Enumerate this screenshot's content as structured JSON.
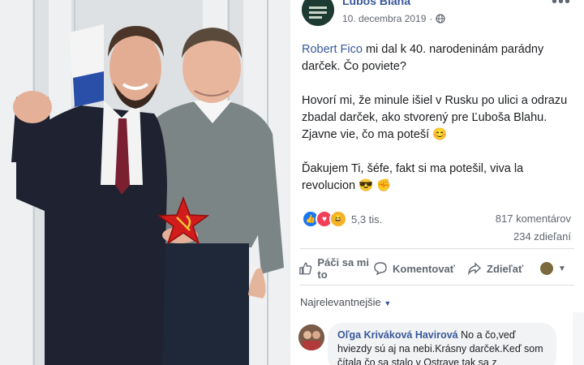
{
  "post": {
    "author": "Ľuboš Blaha",
    "date": "10. decembra 2019",
    "date_separator": "·",
    "audience_icon": "globe-icon",
    "more_glyph": "•••",
    "mention": "Robert Fico",
    "line1_rest": " mi dal k 40. narodeninám parádny darček. Čo poviete?",
    "para2": "Hovorí mi, že minule išiel v Rusku po ulici a odrazu zbadal darček, ako stvorený pre Ľuboša Blahu. Zjavne vie, čo ma poteší ",
    "para2_emoji": "😊",
    "para3": "Ďakujem Ti, šéfe, fakt si ma potešil, viva la revolucion ",
    "para3_emoji1": "😎",
    "para3_emoji2": "✊"
  },
  "stats": {
    "reaction_icons": [
      "like-icon",
      "love-icon",
      "haha-icon"
    ],
    "reactions": "5,3 tis.",
    "comments": "817 komentárov",
    "shares": "234 zdieľaní"
  },
  "actions": {
    "like": "Páči sa mi to",
    "comment": "Komentovať",
    "share": "Zdieľať"
  },
  "comments_section": {
    "sort_label": "Najrelevantnejšie",
    "comment": {
      "author": "Oľga Kriváková Havirová",
      "text": " No a čo,veď hviezdy sú aj na nebi.Krásny darček.Keď som čítala čo sa stalo v Ostrave tak sa z"
    }
  },
  "colors": {
    "link": "#385898",
    "like": "#1877f2",
    "love": "#f33e58",
    "haha": "#f7b125",
    "star": "#d21b1b"
  }
}
